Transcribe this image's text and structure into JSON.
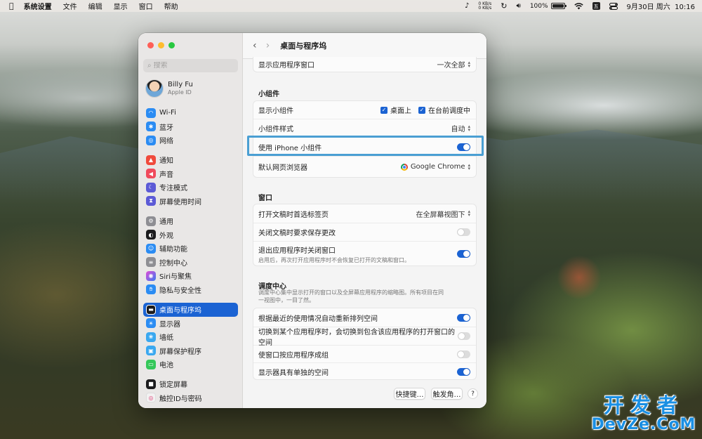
{
  "menubar": {
    "app_name": "系统设置",
    "menus": [
      "文件",
      "编辑",
      "显示",
      "窗口",
      "帮助"
    ],
    "net_up": "0 KB/s",
    "net_down": "0 KB/s",
    "battery_percent": "100%",
    "battery_level": 1.0,
    "datetime": "9月30日 周六  10:16",
    "icons": [
      "apple-icon",
      "text-format-icon",
      "time-machine-icon",
      "volume-icon",
      "battery-icon",
      "wifi-icon",
      "input-method-icon",
      "control-center-icon"
    ]
  },
  "sidebar": {
    "search_placeholder": "搜索",
    "user": {
      "name": "Billy Fu",
      "subtitle": "Apple ID"
    },
    "groups": [
      [
        {
          "label": "Wi-Fi",
          "icon": "wifi-icon",
          "color": "#2b8cf3"
        },
        {
          "label": "蓝牙",
          "icon": "bluetooth-icon",
          "color": "#2b8cf3"
        },
        {
          "label": "网络",
          "icon": "globe-icon",
          "color": "#2b8cf3"
        }
      ],
      [
        {
          "label": "通知",
          "icon": "bell-icon",
          "color": "#f04a3c"
        },
        {
          "label": "声音",
          "icon": "speaker-icon",
          "color": "#f04a5c"
        },
        {
          "label": "专注模式",
          "icon": "moon-icon",
          "color": "#5c5ad6"
        },
        {
          "label": "屏幕使用时间",
          "icon": "hourglass-icon",
          "color": "#5c5ad6"
        }
      ],
      [
        {
          "label": "通用",
          "icon": "gear-icon",
          "color": "#8e8e93"
        },
        {
          "label": "外观",
          "icon": "appearance-icon",
          "color": "#1c1c1e"
        },
        {
          "label": "辅助功能",
          "icon": "accessibility-icon",
          "color": "#2b8cf3"
        },
        {
          "label": "控制中心",
          "icon": "control-center-icon",
          "color": "#8e8e93"
        },
        {
          "label": "Siri与聚焦",
          "icon": "siri-icon",
          "color": "#a14fd8"
        },
        {
          "label": "隐私与安全性",
          "icon": "hand-icon",
          "color": "#2b8cf3"
        }
      ],
      [
        {
          "label": "桌面与程序坞",
          "icon": "dock-icon",
          "color": "#1c1c1e",
          "selected": true
        },
        {
          "label": "显示器",
          "icon": "sun-icon",
          "color": "#2b8cf3"
        },
        {
          "label": "墙纸",
          "icon": "wallpaper-icon",
          "color": "#3aa8f0"
        },
        {
          "label": "屏幕保护程序",
          "icon": "screensaver-icon",
          "color": "#3aa8f0"
        },
        {
          "label": "电池",
          "icon": "battery-icon",
          "color": "#34c759"
        }
      ],
      [
        {
          "label": "锁定屏幕",
          "icon": "lock-icon",
          "color": "#1c1c1e"
        },
        {
          "label": "触控ID与密码",
          "icon": "fingerprint-icon",
          "color": "#f2f2f2"
        }
      ]
    ]
  },
  "content": {
    "title": "桌面与程序坞",
    "top_row": {
      "label": "显示应用程序窗口",
      "value": "一次全部"
    },
    "widgets": {
      "title": "小组件",
      "show_label": "显示小组件",
      "check1": "桌面上",
      "check2": "在台前调度中",
      "style_label": "小组件样式",
      "style_value": "自动",
      "iphone_label": "使用 iPhone 小组件",
      "iphone_on": true,
      "browser_label": "默认网页浏览器",
      "browser_value": "Google Chrome"
    },
    "windows": {
      "title": "窗口",
      "tabs_label": "打开文稿时首选标签页",
      "tabs_value": "在全屏幕视图下",
      "ask_label": "关闭文稿时要求保存更改",
      "ask_on": false,
      "close_label": "退出应用程序时关闭窗口",
      "close_desc": "启用后，再次打开应用程序时不会恢复已打开的文稿和窗口。",
      "close_on": true
    },
    "mission": {
      "title": "调度中心",
      "desc": "调度中心集中显示打开的窗口以及全屏幕应用程序的缩略图。所有项目在同一视图中，一目了然。",
      "rows": [
        {
          "label": "根据最近的使用情况自动重新排列空间",
          "on": true
        },
        {
          "label": "切换到某个应用程序时，会切换到包含该应用程序的打开窗口的空间",
          "on": false
        },
        {
          "label": "使窗口按应用程序成组",
          "on": false
        },
        {
          "label": "显示器具有单独的空间",
          "on": true
        }
      ]
    },
    "buttons": {
      "shortcuts": "快捷键…",
      "hot_corners": "触发角…",
      "help": "?"
    }
  },
  "watermark": {
    "line1": "开发者",
    "line2": "DevZe.CoM"
  }
}
